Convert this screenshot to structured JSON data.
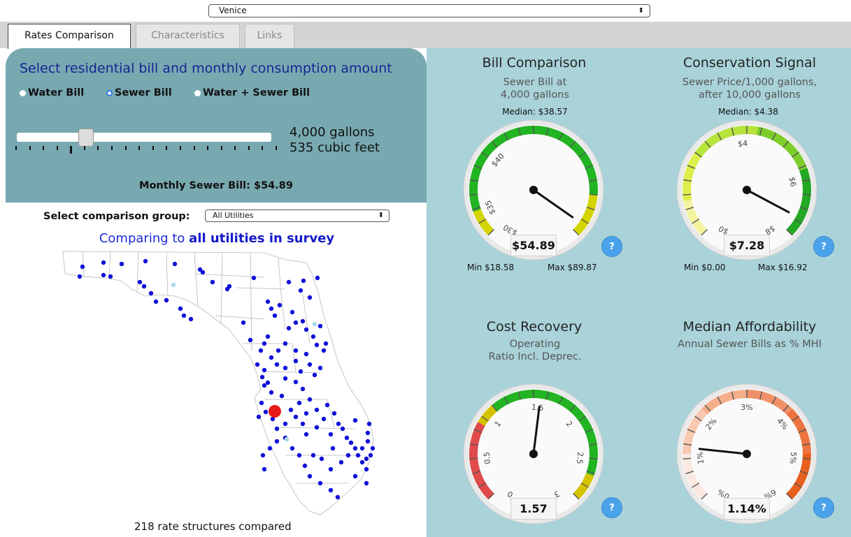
{
  "top_select": {
    "value": "Venice"
  },
  "tabs": [
    {
      "label": "Rates Comparison",
      "active": true
    },
    {
      "label": "Characteristics",
      "active": false
    },
    {
      "label": "Links",
      "active": false
    }
  ],
  "controls": {
    "title": "Select residential bill and monthly consumption amount",
    "radios": [
      {
        "label": "Water Bill",
        "checked": false
      },
      {
        "label": "Sewer Bill",
        "checked": true
      },
      {
        "label": "Water + Sewer Bill",
        "checked": false
      }
    ],
    "slider": {
      "gallons": "4,000 gallons",
      "cubic_feet": "535 cubic feet",
      "position_step": 4,
      "steps": 20
    },
    "monthly_bill": "Monthly Sewer Bill: $54.89"
  },
  "comparison": {
    "label": "Select comparison group:",
    "selected": "All Utilities",
    "heading_prefix": "Comparing to ",
    "heading_bold": "all utilities in survey",
    "footer": "218 rate structures compared"
  },
  "gauges": {
    "bill": {
      "title": "Bill Comparison",
      "subtitle_1": "Sewer Bill at",
      "subtitle_2": "4,000 gallons",
      "median": "Median: $38.57",
      "min": "Min $18.58",
      "max": "Max $89.87",
      "value": "$54.89",
      "scale_labels": [
        "$30",
        "$35",
        "$40"
      ]
    },
    "conservation": {
      "title": "Conservation Signal",
      "subtitle_1": "Sewer Price/1,000 gallons,",
      "subtitle_2": "after 10,000 gallons",
      "median": "Median: $4.38",
      "min": "Min $0.00",
      "max": "Max $16.92",
      "value": "$7.28",
      "scale_labels": [
        "$0",
        "$4",
        "$6",
        "$8"
      ]
    },
    "cost": {
      "title": "Cost Recovery",
      "subtitle_1": "Operating",
      "subtitle_2": "Ratio Incl. Deprec.",
      "value": "1.57",
      "scale_labels": [
        "0",
        "0.5",
        "1",
        "1.5",
        "2",
        "2.5",
        "3"
      ]
    },
    "afford": {
      "title": "Median Affordability",
      "subtitle_1": "Annual Sewer Bills as % MHI",
      "value": "1.14%",
      "scale_labels": [
        "0%",
        "1%",
        "2%",
        "3%",
        "4%",
        "5%",
        "6%"
      ]
    },
    "help_label": "?"
  },
  "colors": {
    "left_panel": "#78a9b1",
    "right_panel": "#a9d2d9",
    "utility_dot": "#1010d8",
    "highlight_dot": "#e81818",
    "light_dot": "#a8d8e8"
  }
}
